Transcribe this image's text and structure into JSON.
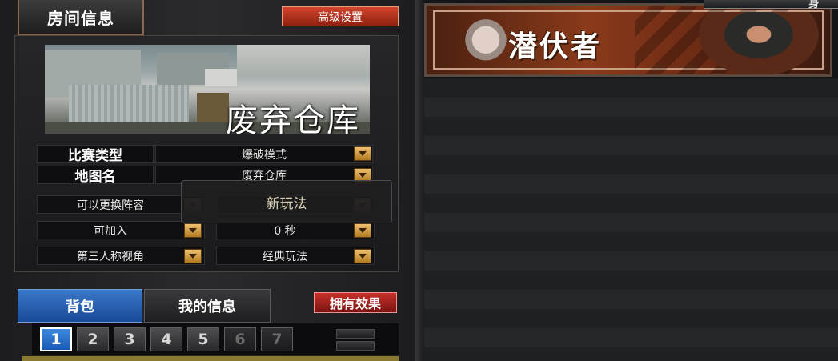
{
  "room": {
    "tab_label": "房间信息",
    "advanced_label": "高级设置",
    "map_name_overlay": "废弃仓库",
    "match_type_label": "比赛类型",
    "match_type_value": "爆破模式",
    "map_label": "地图名",
    "map_value": "废弃仓库",
    "options": {
      "team_change": "可以更换阵容",
      "new_mode": "新玩法",
      "joinable": "可加入",
      "time_value": "0  秒",
      "view_mode": "第三人称视角",
      "play_mode": "经典玩法"
    }
  },
  "inventory": {
    "tab_bag": "背包",
    "tab_info": "我的信息",
    "effects_label": "拥有效果",
    "pages": [
      "1",
      "2",
      "3",
      "4",
      "5",
      "6",
      "7"
    ],
    "active_page": "1"
  },
  "banner": {
    "title": "潜伏者",
    "corner_text": "身"
  },
  "icons": {
    "dropdown": "chevron-down-icon",
    "scroll_up": "scroll-up-icon",
    "scroll_down": "scroll-down-icon"
  },
  "colors": {
    "accent_blue": "#2a68b8",
    "accent_red": "#b02a1c",
    "dropdown_gold": "#d8a040"
  }
}
